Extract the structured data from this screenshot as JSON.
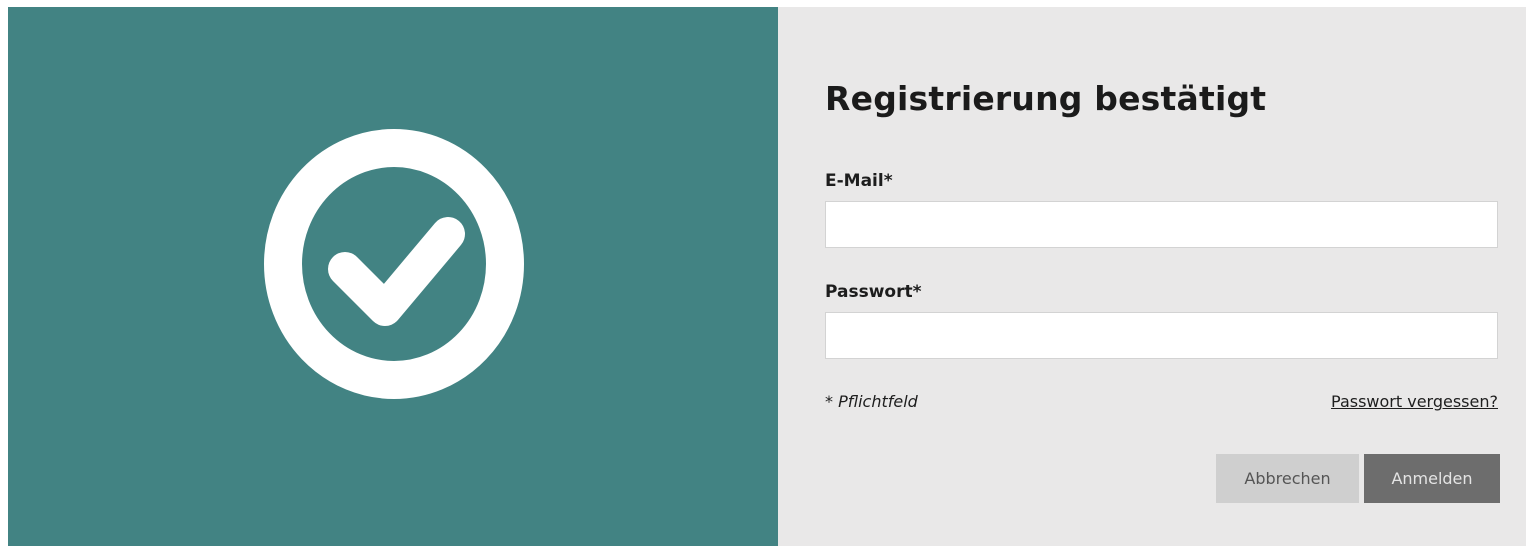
{
  "colors": {
    "panel_teal": "#428383",
    "form_background": "#e9e8e8",
    "icon_white": "#ffffff",
    "cancel_button": "#cfcfcf",
    "login_button": "#6d6d6d"
  },
  "hero": {
    "icon": "check-circle-icon"
  },
  "form": {
    "title": "Registrierung bestätigt",
    "email": {
      "label": "E-Mail*",
      "value": "",
      "placeholder": ""
    },
    "password": {
      "label": "Passwort*",
      "value": "",
      "placeholder": ""
    },
    "required_note": "* Pflichtfeld",
    "forgot_password": "Passwort vergessen?",
    "cancel_label": "Abbrechen",
    "login_label": "Anmelden"
  }
}
